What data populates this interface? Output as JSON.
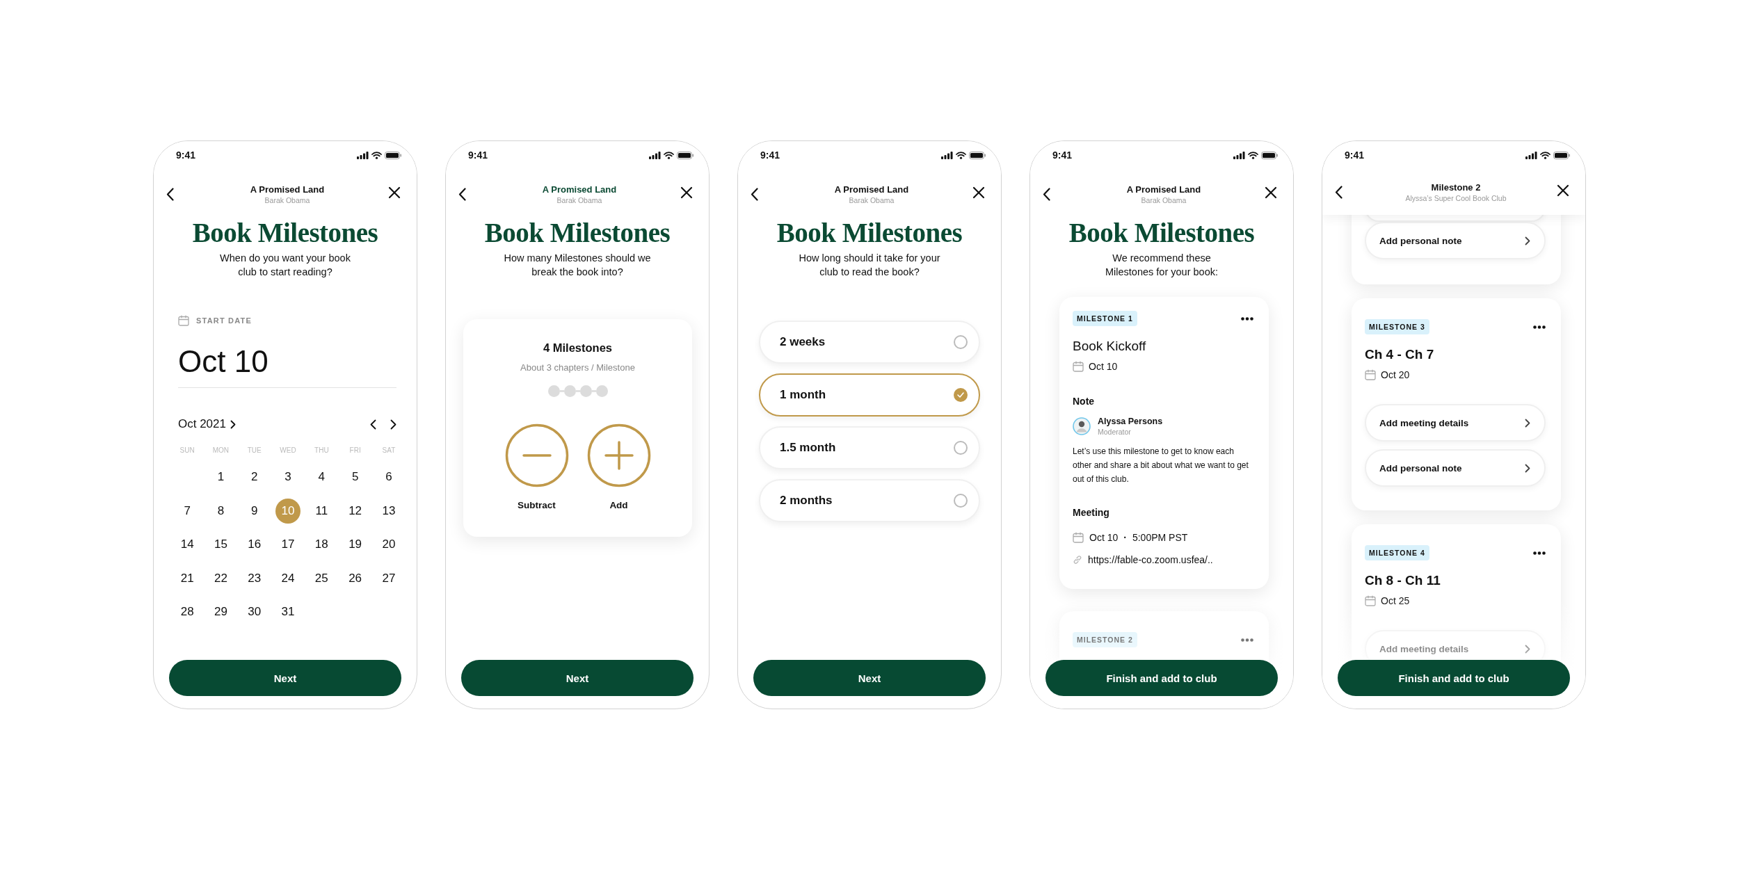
{
  "screens": [
    {
      "kind": "date",
      "status_time": "9:41",
      "header": {
        "title": "A Promised Land",
        "subtitle": "Barak Obama",
        "highlighted": false
      },
      "heading": "Book Milestones",
      "prompt": "When do you want your book club to start reading?",
      "field_label": "START DATE",
      "date_value": "Oct 10",
      "calendar": {
        "month": "Oct 2021",
        "weekdays": [
          "SUN",
          "MON",
          "TUE",
          "WED",
          "THU",
          "FRI",
          "SAT"
        ],
        "weeks": [
          [
            {
              "kind": "blank"
            },
            {
              "kind": "day",
              "day": "1",
              "selected": false
            },
            {
              "day": "2",
              "selected": false
            },
            {
              "day": "3",
              "selected": false
            },
            {
              "day": "4",
              "selected": false
            },
            {
              "day": "5",
              "selected": false
            },
            {
              "day": "6",
              "selected": false
            }
          ],
          [
            {
              "day": "7",
              "selected": false
            },
            {
              "day": "8",
              "selected": false
            },
            {
              "day": "9",
              "selected": false
            },
            {
              "day": "10",
              "selected": true
            },
            {
              "day": "11",
              "selected": false
            },
            {
              "day": "12",
              "selected": false
            },
            {
              "day": "13",
              "selected": false
            }
          ],
          [
            {
              "day": "14",
              "selected": false
            },
            {
              "day": "15",
              "selected": false
            },
            {
              "day": "16",
              "selected": false
            },
            {
              "day": "17",
              "selected": false
            },
            {
              "day": "18",
              "selected": false
            },
            {
              "day": "19",
              "selected": false
            },
            {
              "day": "20",
              "selected": false
            }
          ],
          [
            {
              "day": "21",
              "selected": false
            },
            {
              "day": "22",
              "selected": false
            },
            {
              "day": "23",
              "selected": false
            },
            {
              "day": "24",
              "selected": false
            },
            {
              "day": "25",
              "selected": false
            },
            {
              "day": "26",
              "selected": false
            },
            {
              "day": "27",
              "selected": false
            }
          ],
          [
            {
              "day": "28",
              "selected": false
            },
            {
              "day": "29",
              "selected": false
            },
            {
              "day": "30",
              "selected": false
            },
            {
              "day": "31",
              "selected": false
            }
          ]
        ]
      },
      "button": "Next"
    },
    {
      "kind": "count",
      "status_time": "9:41",
      "header": {
        "title": "A Promised Land",
        "subtitle": "Barak Obama",
        "highlighted": true
      },
      "heading": "Book Milestones",
      "prompt": "How many Milestones should we break the book into?",
      "count_label": "4 Milestones",
      "count_detail": "About 3 chapters / Milestone",
      "steps": [
        {
          "filled": false
        },
        {
          "filled": false
        },
        {
          "filled": false
        },
        {
          "filled": false
        }
      ],
      "actions": [
        {
          "kind": "subtract",
          "label": "Subtract"
        },
        {
          "kind": "add",
          "label": "Add"
        }
      ],
      "button": "Next"
    },
    {
      "kind": "duration",
      "status_time": "9:41",
      "header": {
        "title": "A Promised Land",
        "subtitle": "Barak Obama",
        "highlighted": false
      },
      "heading": "Book Milestones",
      "prompt": "How long should it take for your club to read the book?",
      "options": [
        {
          "label": "2 weeks",
          "selected": false
        },
        {
          "label": "1 month",
          "selected": true
        },
        {
          "label": "1.5 month",
          "selected": false
        },
        {
          "label": "2 months",
          "selected": false
        }
      ],
      "button": "Next"
    },
    {
      "kind": "recommend",
      "status_time": "9:41",
      "header": {
        "title": "A Promised Land",
        "subtitle": "Barak Obama",
        "highlighted": false
      },
      "heading": "Book Milestones",
      "prompt": "We recommend these Milestones for your book:",
      "cards": [
        {
          "kind": "note",
          "tag": "MILESTONE 1",
          "title": "Book Kickoff",
          "date": "Oct 10",
          "note_heading": "Note",
          "author": "Alyssa Persons",
          "role": "Moderator",
          "note": "Let’s use this milestone to get to know each other and share a bit about what we want to get out of this club.",
          "meeting_heading": "Meeting",
          "meeting_date": "Oct 10",
          "meeting_separator": "·",
          "meeting_time": "5:00PM PST",
          "link": "https://fable-co.zoom.usfea/.."
        },
        {
          "kind": "peek",
          "tag": "MILESTONE 2"
        }
      ],
      "button": "Finish and add to club"
    },
    {
      "kind": "detail",
      "status_time": "9:41",
      "header": {
        "title": "Milestone 2",
        "subtitle": "Alyssa’s Super Cool Book Club",
        "highlighted": false
      },
      "cards": [
        {
          "kind": "partial",
          "actions": [
            "Add personal note"
          ]
        },
        {
          "kind": "full",
          "tag": "MILESTONE 3",
          "title": "Ch 4 - Ch 7",
          "date": "Oct 20",
          "actions": [
            "Add meeting details",
            "Add personal note"
          ]
        },
        {
          "kind": "full",
          "tag": "MILESTONE 4",
          "title": "Ch 8 - Ch 11",
          "date": "Oct 25",
          "actions": [
            "Add meeting details"
          ]
        }
      ],
      "button": "Finish and add to club"
    }
  ]
}
